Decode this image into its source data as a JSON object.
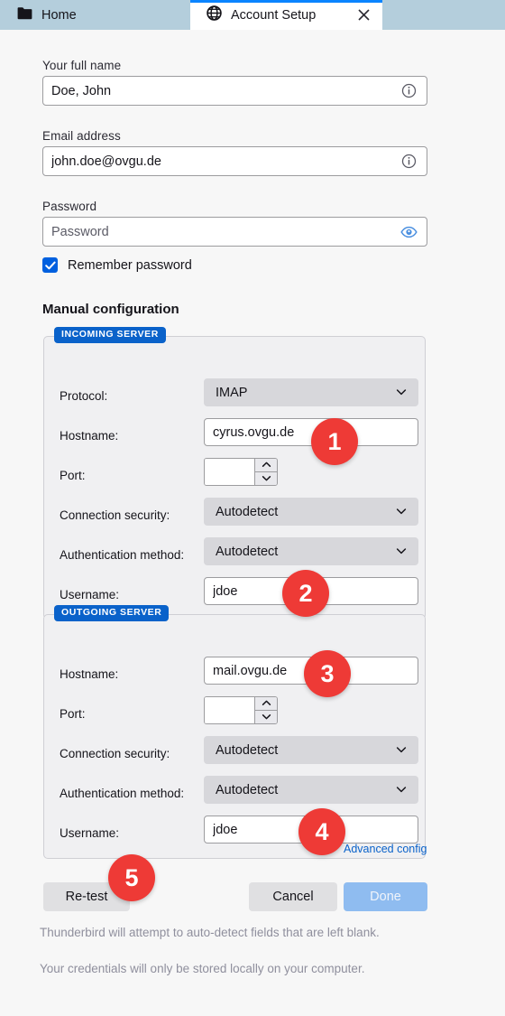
{
  "tabs": [
    {
      "label": "Home",
      "icon": "folder-icon",
      "active": false
    },
    {
      "label": "Account Setup",
      "icon": "globe-icon",
      "active": true,
      "close_icon": "close-icon"
    }
  ],
  "form": {
    "fullname": {
      "label": "Your full name",
      "value": "Doe, John",
      "icon": "info-icon"
    },
    "email": {
      "label": "Email address",
      "value": "john.doe@ovgu.de",
      "icon": "info-icon"
    },
    "password": {
      "label": "Password",
      "placeholder": "Password",
      "value": "",
      "icon": "eye-icon"
    },
    "remember": {
      "label": "Remember password",
      "checked": true
    }
  },
  "manual_heading": "Manual configuration",
  "incoming": {
    "legend": "INCOMING SERVER",
    "rows": {
      "protocol": {
        "label": "Protocol:",
        "value": "IMAP"
      },
      "hostname": {
        "label": "Hostname:",
        "value": "cyrus.ovgu.de"
      },
      "port": {
        "label": "Port:",
        "value": ""
      },
      "security": {
        "label": "Connection security:",
        "value": "Autodetect"
      },
      "auth": {
        "label": "Authentication method:",
        "value": "Autodetect"
      },
      "username": {
        "label": "Username:",
        "value": "jdoe"
      }
    }
  },
  "outgoing": {
    "legend": "OUTGOING SERVER",
    "rows": {
      "hostname": {
        "label": "Hostname:",
        "value": "mail.ovgu.de"
      },
      "port": {
        "label": "Port:",
        "value": ""
      },
      "security": {
        "label": "Connection security:",
        "value": "Autodetect"
      },
      "auth": {
        "label": "Authentication method:",
        "value": "Autodetect"
      },
      "username": {
        "label": "Username:",
        "value": "jdoe"
      }
    }
  },
  "advanced_link": "Advanced config",
  "buttons": {
    "retest": "Re-test",
    "cancel": "Cancel",
    "done": "Done"
  },
  "footnotes": [
    "Thunderbird will attempt to auto-detect fields that are left blank.",
    "Your credentials will only be stored locally on your computer."
  ],
  "callouts": [
    {
      "number": "1"
    },
    {
      "number": "2"
    },
    {
      "number": "3"
    },
    {
      "number": "4"
    },
    {
      "number": "5"
    }
  ],
  "colors": {
    "tabbar": "#b4cedc",
    "accent": "#0a62ca",
    "checkbox": "#0060df",
    "callout": "#ee3a36",
    "done": "#8fbcf0",
    "link": "#0a62ca"
  }
}
